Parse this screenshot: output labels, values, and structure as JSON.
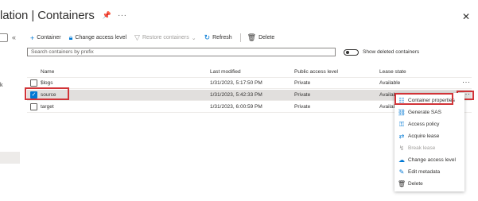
{
  "window": {
    "title": "lation | Containers",
    "pin_icon": "pin-icon",
    "more_icon": "ellipsis-icon",
    "close_icon": "close-icon"
  },
  "sidebar": {
    "collapse_icon": "double-chevron-left-icon",
    "fragment_text": "k"
  },
  "toolbar": {
    "container": "Container",
    "change_access_level": "Change access level",
    "restore_containers": "Restore containers",
    "refresh": "Refresh",
    "delete": "Delete"
  },
  "search": {
    "placeholder": "Search containers by prefix"
  },
  "toggle": {
    "label": "Show deleted containers",
    "on": false
  },
  "table": {
    "headers": [
      "Name",
      "Last modified",
      "Public access level",
      "Lease state"
    ],
    "rows": [
      {
        "name": "$logs",
        "modified": "1/31/2023, 5:17:50 PM",
        "access": "Private",
        "lease": "Available",
        "checked": false
      },
      {
        "name": "source",
        "modified": "1/31/2023, 5:42:33 PM",
        "access": "Private",
        "lease": "Availab",
        "checked": true
      },
      {
        "name": "target",
        "modified": "1/31/2023, 6:00:59 PM",
        "access": "Private",
        "lease": "Availab",
        "checked": false
      }
    ]
  },
  "context_menu": {
    "items": [
      {
        "label": "Container properties",
        "icon": "properties-icon",
        "disabled": false
      },
      {
        "label": "Generate SAS",
        "icon": "link-icon",
        "disabled": false
      },
      {
        "label": "Access policy",
        "icon": "key-icon",
        "disabled": false
      },
      {
        "label": "Acquire lease",
        "icon": "lease-icon",
        "disabled": false
      },
      {
        "label": "Break lease",
        "icon": "break-lease-icon",
        "disabled": true
      },
      {
        "label": "Change access level",
        "icon": "cloud-icon",
        "disabled": false
      },
      {
        "label": "Edit metadata",
        "icon": "edit-icon",
        "disabled": false
      },
      {
        "label": "Delete",
        "icon": "trash-icon",
        "disabled": false
      }
    ]
  },
  "colors": {
    "accent": "#0078d4",
    "highlight": "#d13438"
  }
}
